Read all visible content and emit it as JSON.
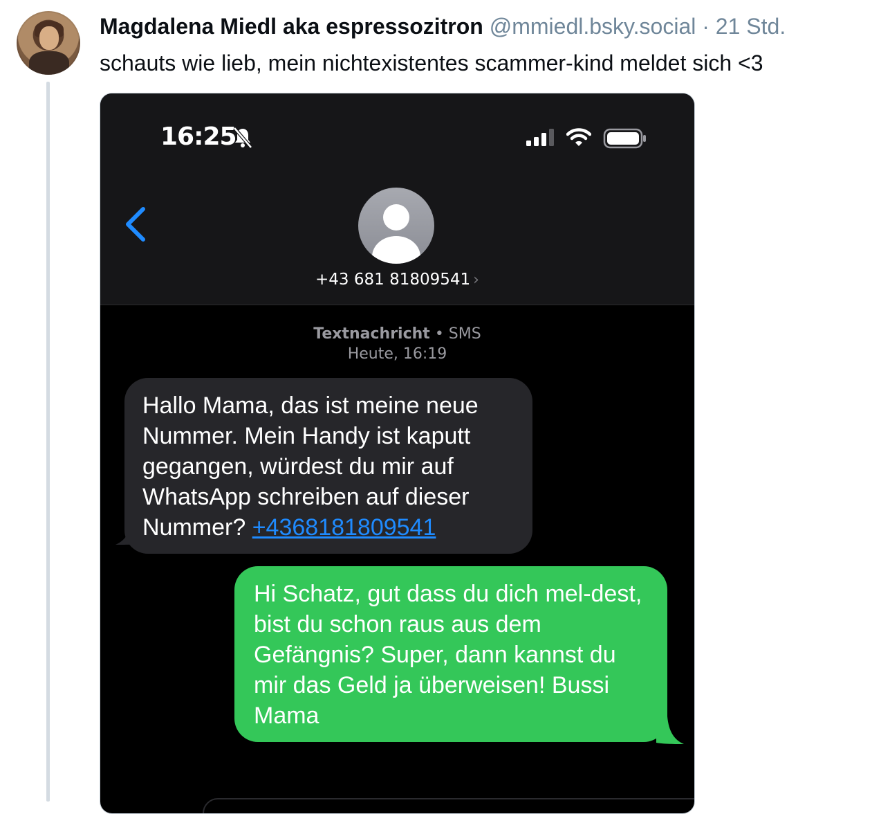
{
  "post": {
    "author": "Magdalena Miedl aka espressozitron",
    "handle": "@mmiedl.bsky.social",
    "separator": " · ",
    "time": "21 Std.",
    "text": "schauts wie lieb, mein nichtexistentes scammer-kind meldet sich <3"
  },
  "phone": {
    "status_time": "16:25",
    "contact_number": "+43 681 81809541",
    "message_type_a": "Textnachricht",
    "message_type_sep": " • ",
    "message_type_b": "SMS",
    "message_date": "Heute, 16:19",
    "incoming_text": "Hallo Mama, das ist meine neue Nummer. Mein Handy ist kaputt gegangen, würdest du mir auf WhatsApp schreiben auf dieser Nummer? ",
    "incoming_link": "+4368181809541",
    "outgoing_text": "Hi Schatz, gut dass du dich mel-dest, bist du schon raus aus dem Gefängnis? Super, dann kannst du mir das Geld ja überweisen! Bussi Mama"
  },
  "colors": {
    "accent_link": "#1f8bff",
    "outgoing_bubble": "#34c759",
    "incoming_bubble": "#26262a"
  },
  "icons": [
    "bell-slash-icon",
    "signal-icon",
    "wifi-icon",
    "battery-icon",
    "back-chevron-icon",
    "contact-avatar-icon",
    "chevron-right-icon"
  ]
}
